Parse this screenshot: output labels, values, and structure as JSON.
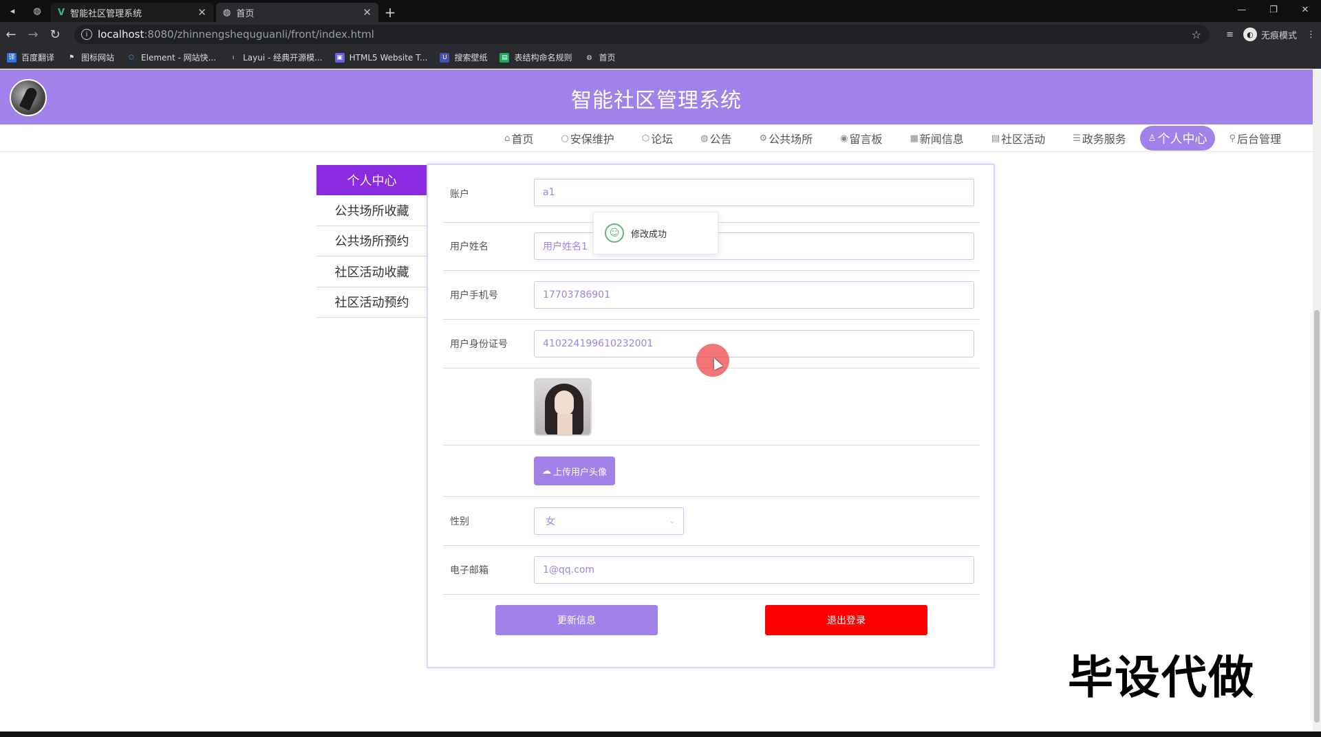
{
  "browser": {
    "tabs": [
      {
        "title": "智能社区管理系统",
        "active": false
      },
      {
        "title": "首页",
        "active": true
      }
    ],
    "url_host": "localhost",
    "url_path": ":8080/zhinnengshequguanli/front/index.html",
    "incognito_label": "无痕模式",
    "bookmarks": [
      {
        "label": "百度翻译",
        "color": "#2f6fed"
      },
      {
        "label": "图标网站",
        "color": "#3a3a3a"
      },
      {
        "label": "Element - 网站快...",
        "color": "#409eff"
      },
      {
        "label": "Layui - 经典开源模...",
        "color": "#3a3a3a"
      },
      {
        "label": "HTML5 Website T...",
        "color": "#6c5ce7"
      },
      {
        "label": "搜索壁纸",
        "color": "#3f51b5"
      },
      {
        "label": "表结构命名规则",
        "color": "#1aab5b"
      },
      {
        "label": "首页",
        "color": "#3a3a3a"
      }
    ]
  },
  "site": {
    "title": "智能社区管理系统",
    "accent": "#a381ea",
    "nav": [
      {
        "label": "首页",
        "icon": "home-icon",
        "glyph": "⌂"
      },
      {
        "label": "安保维护",
        "icon": "circle-icon",
        "glyph": "○"
      },
      {
        "label": "论坛",
        "icon": "shield-icon",
        "glyph": "⬡"
      },
      {
        "label": "公告",
        "icon": "palette-icon",
        "glyph": "◍"
      },
      {
        "label": "公共场所",
        "icon": "network-icon",
        "glyph": "⚙"
      },
      {
        "label": "留言板",
        "icon": "chat-icon",
        "glyph": "◉"
      },
      {
        "label": "新闻信息",
        "icon": "news-icon",
        "glyph": "▦"
      },
      {
        "label": "社区活动",
        "icon": "calendar-icon",
        "glyph": "▤"
      },
      {
        "label": "政务服务",
        "icon": "sliders-icon",
        "glyph": "☰"
      },
      {
        "label": "个人中心",
        "icon": "user-icon",
        "glyph": "♙",
        "active": true
      },
      {
        "label": "后台管理",
        "icon": "link-icon",
        "glyph": "⚲"
      }
    ]
  },
  "sidebar": {
    "header": "个人中心",
    "items": [
      "公共场所收藏",
      "公共场所预约",
      "社区活动收藏",
      "社区活动预约"
    ]
  },
  "form": {
    "account_label": "账户",
    "account_value": "a1",
    "name_label": "用户姓名",
    "name_value": "用户姓名1",
    "phone_label": "用户手机号",
    "phone_value": "17703786901",
    "idcard_label": "用户身份证号",
    "idcard_value": "410224199610232001",
    "upload_label": "上传用户头像",
    "gender_label": "性别",
    "gender_value": "女",
    "email_label": "电子邮箱",
    "email_value": "1@qq.com",
    "update_label": "更新信息",
    "logout_label": "退出登录"
  },
  "toast": {
    "message": "修改成功"
  },
  "watermark": "毕设代做"
}
